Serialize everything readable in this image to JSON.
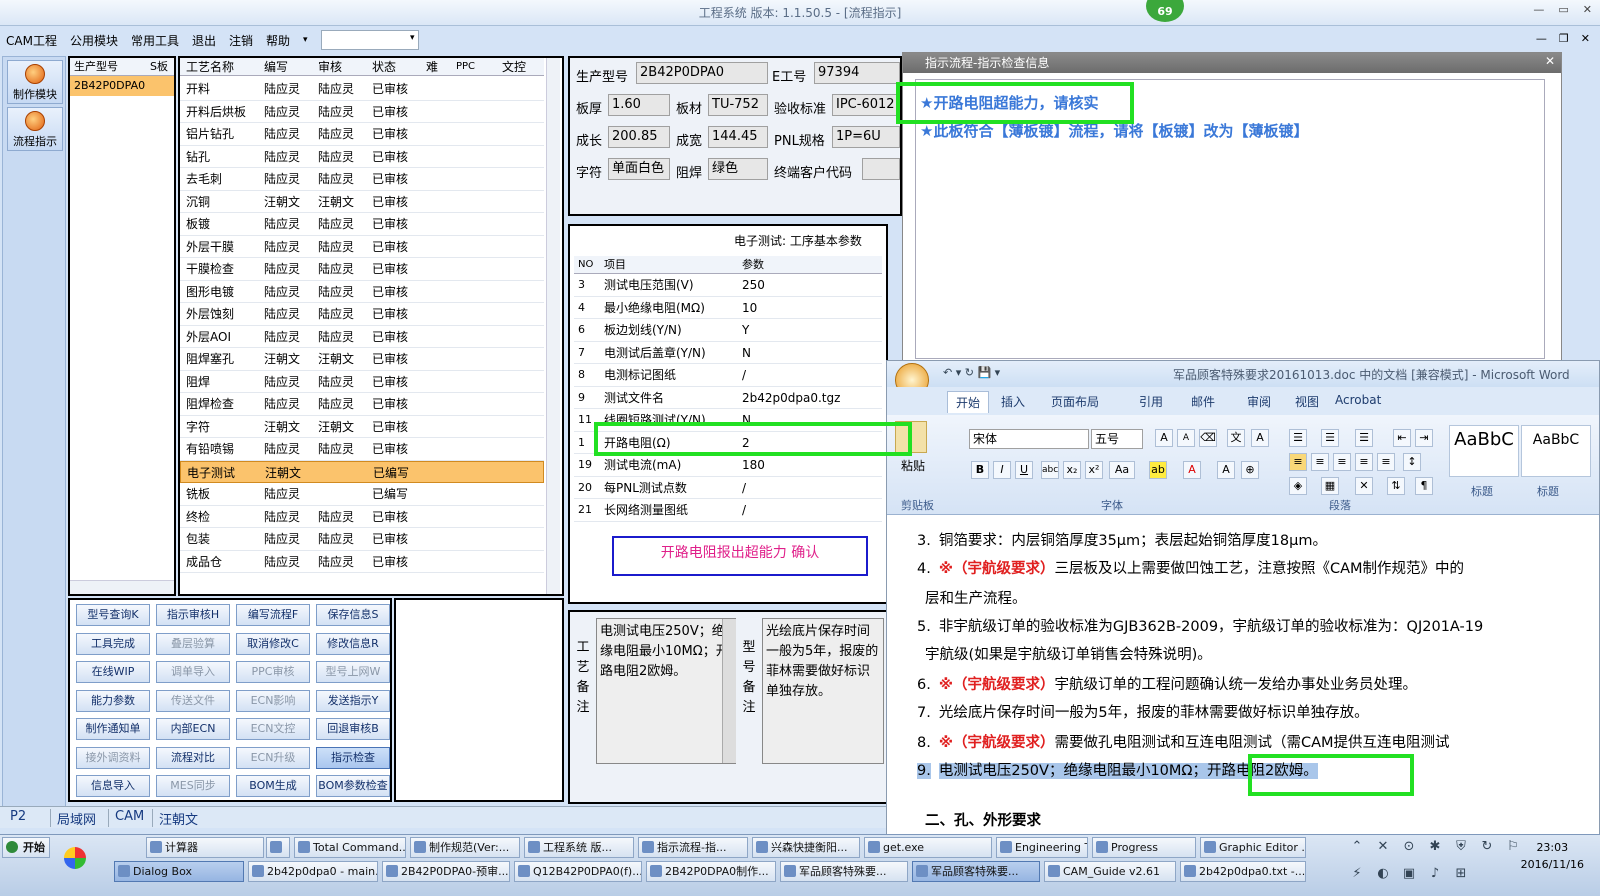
{
  "app_title": "工程系统  版本: 1.1.50.5 - [流程指示]",
  "badge": "69",
  "menu": [
    "CAM工程",
    "公用模块",
    "常用工具",
    "退出",
    "注销",
    "帮助"
  ],
  "leftnav": [
    "制作模块",
    "流程指示"
  ],
  "prod": {
    "headers": [
      "生产型号",
      "S板"
    ],
    "selected": "2B42P0DPA0"
  },
  "proc": {
    "headers": [
      "工艺名称",
      "编写",
      "审核",
      "状态",
      "难",
      "PPC",
      "文控"
    ],
    "rows": [
      [
        "开料",
        "陆应灵",
        "陆应灵",
        "已审核"
      ],
      [
        "开料后烘板",
        "陆应灵",
        "陆应灵",
        "已审核"
      ],
      [
        "铝片钻孔",
        "陆应灵",
        "陆应灵",
        "已审核"
      ],
      [
        "钻孔",
        "陆应灵",
        "陆应灵",
        "已审核"
      ],
      [
        "去毛刺",
        "陆应灵",
        "陆应灵",
        "已审核"
      ],
      [
        "沉铜",
        "汪朝文",
        "汪朝文",
        "已审核"
      ],
      [
        "板镀",
        "陆应灵",
        "陆应灵",
        "已审核"
      ],
      [
        "外层干膜",
        "陆应灵",
        "陆应灵",
        "已审核"
      ],
      [
        "干膜检查",
        "陆应灵",
        "陆应灵",
        "已审核"
      ],
      [
        "图形电镀",
        "陆应灵",
        "陆应灵",
        "已审核"
      ],
      [
        "外层蚀刻",
        "陆应灵",
        "陆应灵",
        "已审核"
      ],
      [
        "外层AOI",
        "陆应灵",
        "陆应灵",
        "已审核"
      ],
      [
        "阻焊塞孔",
        "汪朝文",
        "汪朝文",
        "已审核"
      ],
      [
        "阻焊",
        "陆应灵",
        "陆应灵",
        "已审核"
      ],
      [
        "阻焊检查",
        "陆应灵",
        "陆应灵",
        "已审核"
      ],
      [
        "字符",
        "汪朝文",
        "汪朝文",
        "已审核"
      ],
      [
        "有铅喷锡",
        "陆应灵",
        "陆应灵",
        "已审核"
      ],
      [
        "电子测试",
        "汪朝文",
        "",
        "已编写"
      ],
      [
        "铣板",
        "陆应灵",
        "",
        "已编写"
      ],
      [
        "终检",
        "陆应灵",
        "陆应灵",
        "已审核"
      ],
      [
        "包装",
        "陆应灵",
        "陆应灵",
        "已审核"
      ],
      [
        "成品仓",
        "陆应灵",
        "陆应灵",
        "已审核"
      ]
    ]
  },
  "buttons": [
    [
      "型号查询K",
      "指示审核H",
      "编写流程F",
      "保存信息S"
    ],
    [
      "工具完成",
      "叠层验算",
      "取消修改C",
      "修改信息R"
    ],
    [
      "在线WIP",
      "调单导入",
      "PPC审核",
      "型号上网W"
    ],
    [
      "能力参数",
      "传送文件",
      "ECN影响",
      "发送指示Y"
    ],
    [
      "制作通知单",
      "内部ECN",
      "ECN文控",
      "回退审核B"
    ],
    [
      "接外调资料",
      "流程对比",
      "ECN升级",
      "指示检查"
    ],
    [
      "信息导入",
      "MES同步",
      "BOM生成",
      "BOM参数检查"
    ]
  ],
  "info": {
    "model_label": "生产型号",
    "model": "2B42P0DPA0",
    "eng_label": "E工号",
    "eng": "97394",
    "thick_label": "板厚",
    "thick": "1.60",
    "mat_label": "板材",
    "mat": "TU-752",
    "std_label": "验收标准",
    "std": "IPC-6012",
    "len_label": "成长",
    "len": "200.85",
    "wid_label": "成宽",
    "wid": "144.45",
    "pnl_label": "PNL规格",
    "pnl": "1P=6U",
    "char_label": "字符",
    "char": "单面白色",
    "mask_label": "阻焊",
    "mask": "绿色",
    "cust_label": "终端客户代码",
    "cust": ""
  },
  "test": {
    "title": "电子测试: 工序基本参数",
    "headers": [
      "NO",
      "项目",
      "参数"
    ],
    "rows": [
      [
        "3",
        "测试电压范围(V)",
        "250"
      ],
      [
        "4",
        "最小绝缘电阻(MΩ)",
        "10"
      ],
      [
        "6",
        "板边划线(Y/N)",
        "Y"
      ],
      [
        "7",
        "电测试后盖章(Y/N)",
        "N"
      ],
      [
        "8",
        "电测标记图纸",
        "/"
      ],
      [
        "9",
        "测试文件名",
        "2b42p0dpa0.tgz"
      ],
      [
        "11",
        "线圈短路测试(Y/N)",
        "N"
      ],
      [
        "1",
        "开路电阻(Ω)",
        "2"
      ],
      [
        "19",
        "测试电流(mA)",
        "180"
      ],
      [
        "20",
        "每PNL测试点数",
        "/"
      ],
      [
        "21",
        "长网络测量图纸",
        "/"
      ]
    ],
    "confirm": "开路电阻报出超能力   确认"
  },
  "remarks": {
    "proc_label": "工艺备注",
    "proc_text": "电测试电压250V；绝缘电阻最小10MΩ；开路电阻2欧姆。",
    "model_label": "型号备注",
    "model_text": "光绘底片保存时间一般为5年，报废的菲林需要做好标识单独存放。"
  },
  "flow": {
    "title": "指示流程-指示检查信息",
    "line1": "★开路电阻超能力，请核实",
    "line2": "★此板符合【薄板镀】流程，请将【板镀】改为【薄板镀】"
  },
  "word": {
    "title": "军品顾客特殊要求20161013.doc 中的文档 [兼容模式] - Microsoft Word",
    "tabs": [
      "开始",
      "插入",
      "页面布局",
      "引用",
      "邮件",
      "审阅",
      "视图",
      "Acrobat"
    ],
    "groups": [
      "剪贴板",
      "字体",
      "段落",
      "标题"
    ],
    "font": "宋体",
    "size": "五号",
    "paste": "粘贴",
    "styles": [
      "AaBbC",
      "AaBbC"
    ],
    "lines": [
      {
        "num": "3.",
        "red": "",
        "text": "铜箔要求：内层铜箔厚度35μm；表层起始铜箔厚度18μm。"
      },
      {
        "num": "4.",
        "red": "※（宇航级要求）",
        "text": "三层板及以上需要做凹蚀工艺，注意按照《CAM制作规范》中的"
      },
      {
        "num": "",
        "red": "",
        "text": "层和生产流程。"
      },
      {
        "num": "5.",
        "red": "",
        "text": "非宇航级订单的验收标准为GJB362B-2009，宇航级订单的验收标准为：QJ201A-19"
      },
      {
        "num": "",
        "red": "",
        "text": "宇航级(如果是宇航级订单销售会特殊说明)。"
      },
      {
        "num": "6.",
        "red": "※（宇航级要求）",
        "text": "宇航级订单的工程问题确认统一发给办事处业务员处理。"
      },
      {
        "num": "7.",
        "red": "",
        "text": "光绘底片保存时间一般为5年，报废的菲林需要做好标识单独存放。"
      },
      {
        "num": "8.",
        "red": "※（宇航级要求）",
        "text": "需要做孔电阻测试和互连电阻测试（需CAM提供互连电阻测试"
      },
      {
        "num": "9.",
        "red": "",
        "text": "电测试电压250V；绝缘电阻最小10MΩ；开路电阻2欧姆。"
      },
      {
        "num": "",
        "red": "",
        "text": ""
      },
      {
        "num": "",
        "red": "",
        "text": "二、孔、外形要求"
      }
    ]
  },
  "status_tabs": [
    "P2",
    "局域网",
    "CAM",
    "汪朝文"
  ],
  "taskbar": {
    "start": "开始",
    "row1": [
      "计算器",
      "",
      "Total Command...",
      "制作规范(Ver:...",
      "工程系统 版...",
      "指示流程-指...",
      "兴森快捷衡阳...",
      "get.exe",
      "Engineering To...",
      "Progress",
      "Graphic Editor ..."
    ],
    "row2": [
      "Dialog Box",
      "2b42p0dpa0 - main...",
      "2B42P0DPA0-预审...",
      "Q12B42P0DPA0(f)...",
      "2B42P0DPA0制作...",
      "军品顾客特殊要...",
      "军品顾客特殊要...",
      "CAM_Guide v2.61",
      "2b42p0dpa0.txt -..."
    ],
    "time": "23:03",
    "date": "2016/11/16"
  }
}
